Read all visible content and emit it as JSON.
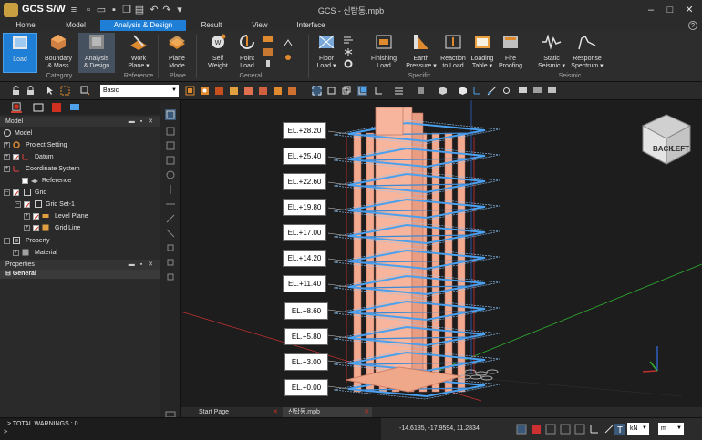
{
  "app": {
    "name": "GCS S/W",
    "window_title": "GCS - 신탑동.mpb"
  },
  "menu": {
    "tabs": [
      "Home",
      "Model",
      "Analysis & Design",
      "Result",
      "View",
      "Interface"
    ],
    "active": "Analysis & Design",
    "help": "?"
  },
  "ribbon": {
    "buttons": {
      "load": "Load",
      "boundary_mass": "Boundary\n& Mass",
      "analysis_design": "Analysis\n& Design",
      "work_plane": "Work\nPlane ▾",
      "plane_mode": "Plane\nMode",
      "self_weight": "Self\nWeight",
      "point_load": "Point\nLoad",
      "floor_load": "Floor\nLoad ▾",
      "finishing_load": "Finishing\nLoad",
      "earth_pressure": "Earth\nPressure ▾",
      "reaction_to_load": "Reaction\nto Load",
      "loading_table": "Loading\nTable ▾",
      "fire_proofing": "Fire\nProofing",
      "static_seismic": "Static\nSeismic ▾",
      "response_spectrum": "Response\nSpectrum ▾"
    },
    "groups": {
      "category": "Category",
      "reference": "Reference",
      "plane": "Plane",
      "general": "General",
      "specific": "Specific",
      "seismic": "Seismic"
    },
    "colors": {
      "accent": "#1f7fd6"
    }
  },
  "toolbar": {
    "style_select": "Basic"
  },
  "model_panel": {
    "title": "Model",
    "controls": "▬ ▪ ✕",
    "items": [
      {
        "label": "Model"
      },
      {
        "label": "Project Setting"
      },
      {
        "label": "Datum"
      },
      {
        "label": "Coordinate System"
      },
      {
        "label": "Reference"
      },
      {
        "label": "Grid"
      },
      {
        "label": "Grid Set-1"
      },
      {
        "label": "Level Plane"
      },
      {
        "label": "Grid Line"
      },
      {
        "label": "Property"
      },
      {
        "label": "Material"
      }
    ]
  },
  "properties_panel": {
    "title": "Properties",
    "controls": "▬ ▪ ✕",
    "section": "General"
  },
  "viewport": {
    "elevations": [
      "EL.+28.20",
      "EL.+25.40",
      "EL.+22.60",
      "EL.+19.80",
      "EL.+17.00",
      "EL.+14.20",
      "EL.+11.40",
      "EL.+8.60",
      "EL.+5.80",
      "EL.+3.00",
      "EL.+0.00"
    ],
    "viewcube": {
      "back": "BACK",
      "left": "LEFT"
    }
  },
  "doc_tabs": {
    "start": "Start Page",
    "file": "신탑동.mpb"
  },
  "status": {
    "warnings": "> TOTAL WARNINGS : 0",
    "prompt": ">",
    "coords": "-14.6185, -17.9594, 11.2834",
    "force_unit": "kN",
    "length_unit": "m"
  }
}
